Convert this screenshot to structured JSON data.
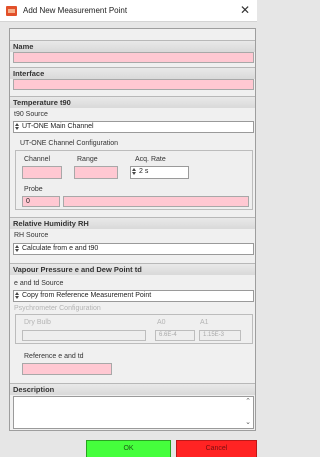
{
  "window": {
    "title": "Add New Measurement Point",
    "close_glyph": "✕"
  },
  "sections": {
    "name": {
      "header": "Name",
      "value": ""
    },
    "interface": {
      "header": "Interface",
      "value": ""
    },
    "temperature": {
      "header": "Temperature t90",
      "source_label": "t90 Source",
      "source_value": "UT-ONE Main Channel",
      "config_label": "UT-ONE Channel Configuration",
      "channel_label": "Channel",
      "range_label": "Range",
      "acq_rate_label": "Acq. Rate",
      "acq_rate_value": "2 s",
      "probe_label": "Probe",
      "probe_value": "0"
    },
    "humidity": {
      "header": "Relative Humidity RH",
      "source_label": "RH Source",
      "source_value": "Calculate from e and t90"
    },
    "vapour": {
      "header": "Vapour Pressure e and Dew Point td",
      "source_label": "e and td Source",
      "source_value": "Copy from Reference Measurement Point",
      "psychro_label": "Psychrometer Configuration",
      "dry_bulb_label": "Dry Bulb",
      "a0_label": "A0",
      "a1_label": "A1",
      "a0_value": "6.6E-4",
      "a1_value": "1.15E-3",
      "reference_label": "Reference e and td"
    },
    "description": {
      "header": "Description"
    }
  },
  "buttons": {
    "ok": "OK",
    "cancel": "Cancel"
  },
  "colors": {
    "required_field": "#ffc8d2",
    "ok_button": "#45ff3c",
    "cancel_button": "#ff2323"
  },
  "icons": {
    "app": "measurement-app-icon",
    "spin": "spin-arrows-icon",
    "scroll_up": "scroll-up-icon",
    "scroll_down": "scroll-down-icon"
  }
}
